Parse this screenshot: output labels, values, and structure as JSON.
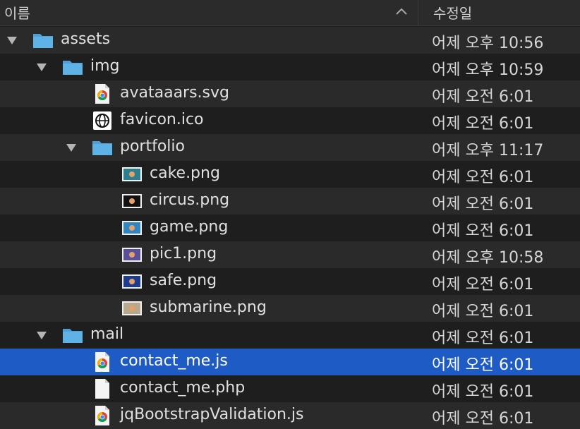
{
  "header": {
    "name_label": "이름",
    "date_label": "수정일",
    "sort_icon": "chevron-up-icon"
  },
  "colors": {
    "background": "#1e1e1e",
    "alt_row": "#2a2a2a",
    "selected": "#1f5bc4",
    "folder": "#5fb2e6"
  },
  "rows": [
    {
      "name": "assets",
      "date": "어제 오후 10:56",
      "depth": 0,
      "type": "folder",
      "expanded": true
    },
    {
      "name": "img",
      "date": "어제 오후 10:59",
      "depth": 1,
      "type": "folder",
      "expanded": true
    },
    {
      "name": "avataaars.svg",
      "date": "어제 오전 6:01",
      "depth": 2,
      "type": "chrome"
    },
    {
      "name": "favicon.ico",
      "date": "어제 오전 6:01",
      "depth": 2,
      "type": "globe"
    },
    {
      "name": "portfolio",
      "date": "어제 오후 11:17",
      "depth": 2,
      "type": "folder",
      "expanded": true
    },
    {
      "name": "cake.png",
      "date": "어제 오전 6:01",
      "depth": 3,
      "type": "image",
      "thumb": "#2c7f8f"
    },
    {
      "name": "circus.png",
      "date": "어제 오전 6:01",
      "depth": 3,
      "type": "image",
      "thumb": "#111111"
    },
    {
      "name": "game.png",
      "date": "어제 오전 6:01",
      "depth": 3,
      "type": "image",
      "thumb": "#2f86c2"
    },
    {
      "name": "pic1.png",
      "date": "어제 오후 10:58",
      "depth": 3,
      "type": "image",
      "thumb": "#5a4f9a"
    },
    {
      "name": "safe.png",
      "date": "어제 오전 6:01",
      "depth": 3,
      "type": "image",
      "thumb": "#1c3d8f"
    },
    {
      "name": "submarine.png",
      "date": "어제 오전 6:01",
      "depth": 3,
      "type": "image",
      "thumb": "#b7a88e"
    },
    {
      "name": "mail",
      "date": "어제 오전 6:01",
      "depth": 1,
      "type": "folder",
      "expanded": true
    },
    {
      "name": "contact_me.js",
      "date": "어제 오전 6:01",
      "depth": 2,
      "type": "chrome",
      "selected": true
    },
    {
      "name": "contact_me.php",
      "date": "어제 오전 6:01",
      "depth": 2,
      "type": "document"
    },
    {
      "name": "jqBootstrapValidation.js",
      "date": "어제 오전 6:01",
      "depth": 2,
      "type": "chrome"
    }
  ]
}
